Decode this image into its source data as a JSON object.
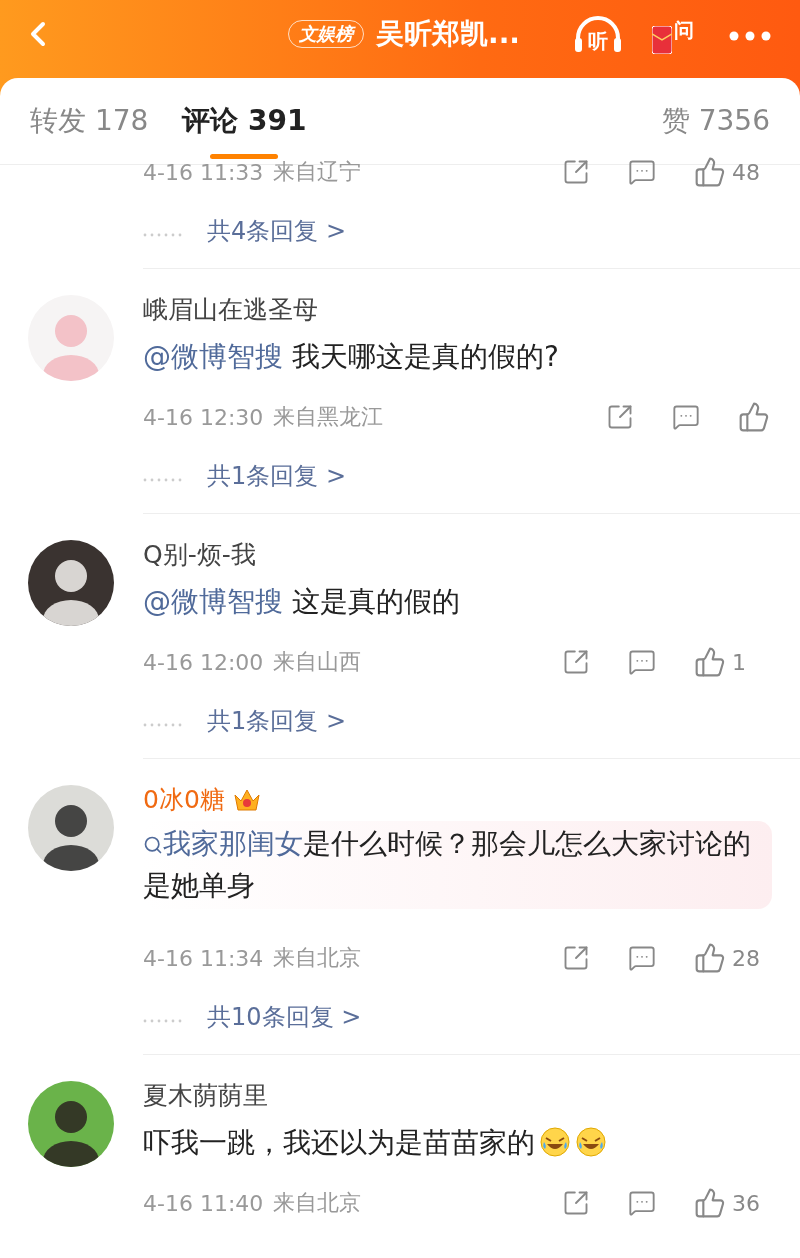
{
  "header": {
    "badge": "文娱榜",
    "title": "吴昕郑凯...",
    "listen": "听",
    "ask": "问"
  },
  "tabs": [
    {
      "label": "转发 178",
      "selected": false
    },
    {
      "label": "评论 391",
      "selected": true
    },
    {
      "label": "赞 7356",
      "selected": false
    }
  ],
  "comments": [
    {
      "time": "4-16 11:33",
      "location": "来自辽宁",
      "likes": "48",
      "replies": "共4条回复 >"
    },
    {
      "name": "峨眉山在逃圣母",
      "vip": false,
      "bubble": false,
      "segments": [
        {
          "kind": "mention",
          "text": "@微博智搜"
        },
        {
          "kind": "plain",
          "text": " 我天哪这是真的假的?"
        }
      ],
      "time": "4-16 12:30",
      "location": "来自黑龙江",
      "replies": "共1条回复 >"
    },
    {
      "name": "Q别-烦-我",
      "vip": false,
      "bubble": false,
      "segments": [
        {
          "kind": "mention",
          "text": "@微博智搜"
        },
        {
          "kind": "plain",
          "text": " 这是真的假的"
        }
      ],
      "time": "4-16 12:00",
      "location": "来自山西",
      "likes": "1",
      "replies": "共1条回复 >"
    },
    {
      "name": "0冰0糖",
      "vip": true,
      "bubble": true,
      "segments": [
        {
          "kind": "topic",
          "text": "我家那闺女"
        },
        {
          "kind": "plain",
          "text": "是什么时候？那会儿怎么大家讨论的是她单身"
        }
      ],
      "time": "4-16 11:34",
      "location": "来自北京",
      "likes": "28",
      "replies": "共10条回复 >"
    },
    {
      "name": "夏木荫荫里",
      "vip": false,
      "bubble": false,
      "segments": [
        {
          "kind": "plain",
          "text": "吓我一跳，我还以为是苗苗家的"
        },
        {
          "kind": "emoji"
        },
        {
          "kind": "emoji"
        }
      ],
      "time": "4-16 11:40",
      "location": "来自北京",
      "likes": "36"
    }
  ]
}
